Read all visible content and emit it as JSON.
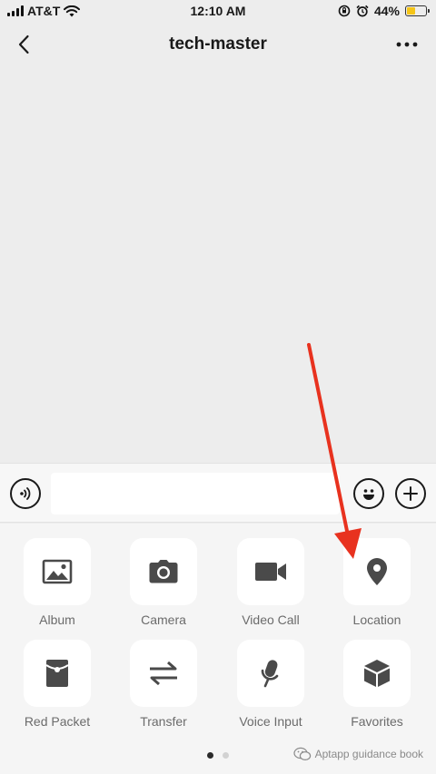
{
  "status_bar": {
    "carrier": "AT&T",
    "time": "12:10 AM",
    "battery_percent": "44%",
    "battery_level": 0.44,
    "icons": [
      "signal-icon",
      "wifi-icon",
      "orientation-lock-icon",
      "alarm-icon",
      "battery-icon"
    ]
  },
  "nav": {
    "title": "tech-master",
    "back_icon": "chevron-left-icon",
    "more_icon": "more-dots-icon"
  },
  "input_bar": {
    "value": "",
    "voice_icon": "voice-icon",
    "emoji_icon": "emoji-icon",
    "plus_icon": "plus-icon"
  },
  "panel": {
    "items": [
      {
        "label": "Album",
        "icon": "image-icon"
      },
      {
        "label": "Camera",
        "icon": "camera-icon"
      },
      {
        "label": "Video Call",
        "icon": "video-camera-icon"
      },
      {
        "label": "Location",
        "icon": "location-pin-icon"
      },
      {
        "label": "Red Packet",
        "icon": "red-packet-icon"
      },
      {
        "label": "Transfer",
        "icon": "transfer-arrows-icon"
      },
      {
        "label": "Voice Input",
        "icon": "microphone-icon"
      },
      {
        "label": "Favorites",
        "icon": "cube-icon"
      }
    ],
    "page_count": 2,
    "active_page": 1
  },
  "watermark": {
    "text": "Aptapp guidance book"
  },
  "colors": {
    "background": "#ededed",
    "panel": "#f5f5f5",
    "icon": "#4a4a4a",
    "annotation_arrow": "#e8321f",
    "battery_fill": "#f5c518"
  }
}
